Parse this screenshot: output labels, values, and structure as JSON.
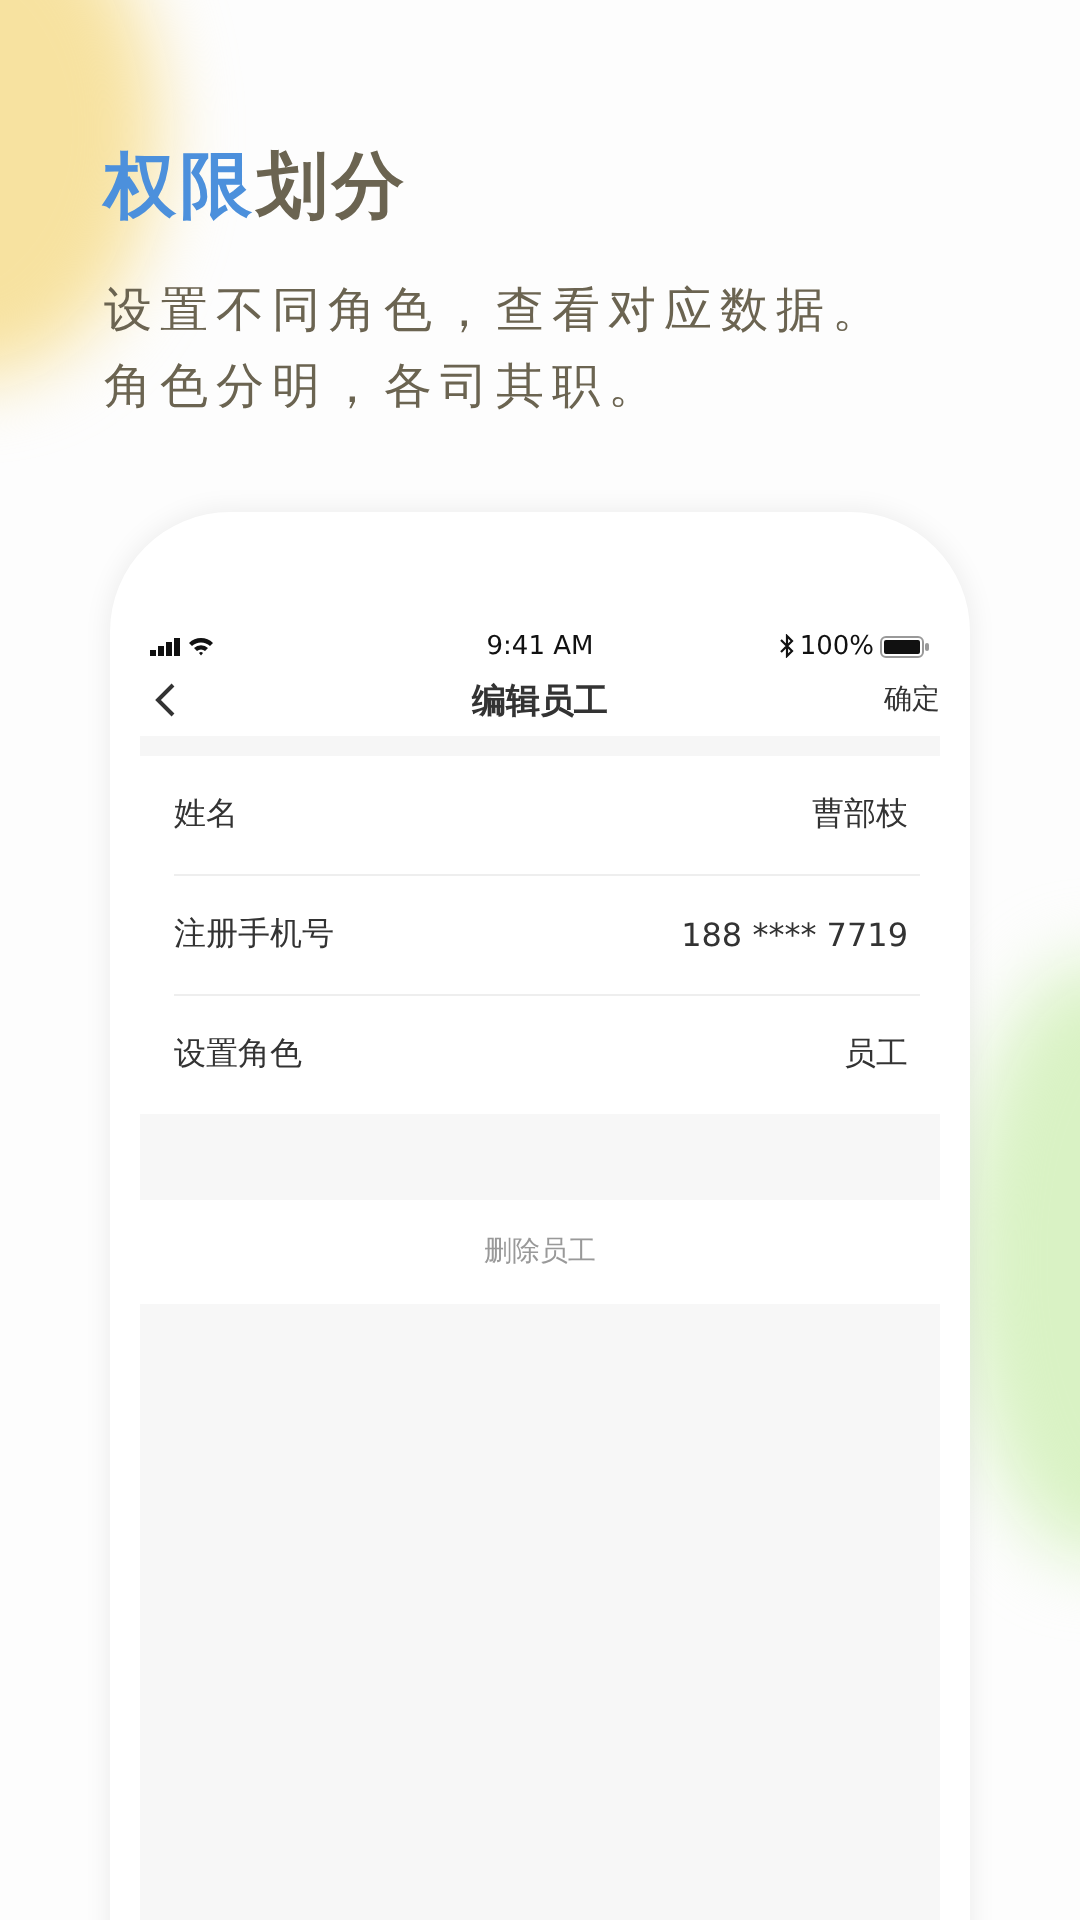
{
  "headline": {
    "highlight": "权限",
    "rest": "划分"
  },
  "subtitle": [
    "设置不同角色，查看对应数据。",
    "角色分明，各司其职。"
  ],
  "status_bar": {
    "time": "9:41 AM",
    "battery": "100%"
  },
  "nav": {
    "title": "编辑员工",
    "action": "确定"
  },
  "fields": [
    {
      "label": "姓名",
      "value": "曹部枝"
    },
    {
      "label": "注册手机号",
      "value": "188 **** 7719"
    },
    {
      "label": "设置角色",
      "value": "员工"
    }
  ],
  "delete_button": "删除员工"
}
